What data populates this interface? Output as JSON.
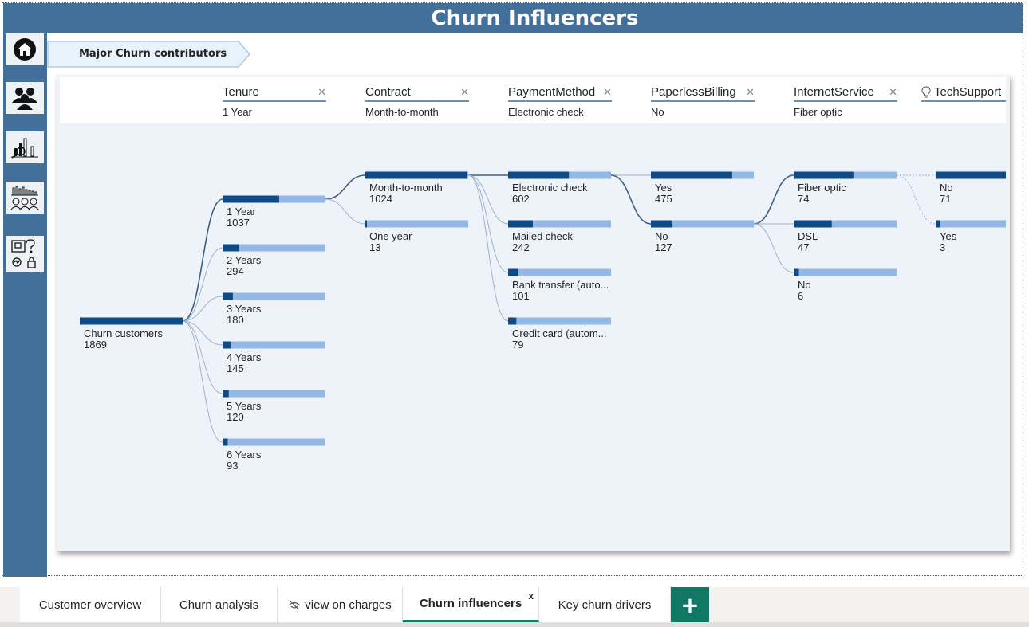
{
  "title": "Churn Influencers",
  "major_button": "Major Churn contributors",
  "nav": [
    {
      "name": "home-icon"
    },
    {
      "name": "customers-icon"
    },
    {
      "name": "analysis-chart-icon"
    },
    {
      "name": "charges-chart-icon"
    },
    {
      "name": "help-icon"
    }
  ],
  "levels": [
    {
      "name": "Tenure",
      "value": "1 Year",
      "closable": true
    },
    {
      "name": "Contract",
      "value": "Month-to-month",
      "closable": true
    },
    {
      "name": "PaymentMethod",
      "value": "Electronic check",
      "closable": true
    },
    {
      "name": "PaperlessBilling",
      "value": "No",
      "closable": true
    },
    {
      "name": "InternetService",
      "value": "Fiber optic",
      "closable": true
    },
    {
      "name": "TechSupport",
      "value": "",
      "closable": false
    }
  ],
  "colors": {
    "dark": "#0e4a85",
    "light": "#92b8e3",
    "accent": "#117865",
    "header": "#436f9b"
  },
  "chart_data": {
    "type": "decomposition-tree",
    "root": {
      "label": "Churn customers",
      "value": 1869,
      "share": 1.0
    },
    "columns": [
      [
        {
          "label": "1 Year",
          "value": 1037,
          "share": 0.55,
          "selected": true
        },
        {
          "label": "2 Years",
          "value": 294,
          "share": 0.16
        },
        {
          "label": "3 Years",
          "value": 180,
          "share": 0.1
        },
        {
          "label": "4 Years",
          "value": 145,
          "share": 0.08
        },
        {
          "label": "5 Years",
          "value": 120,
          "share": 0.06
        },
        {
          "label": "6 Years",
          "value": 93,
          "share": 0.05
        }
      ],
      [
        {
          "label": "Month-to-month",
          "value": 1024,
          "share": 0.99,
          "selected": true
        },
        {
          "label": "One year",
          "value": 13,
          "share": 0.01
        }
      ],
      [
        {
          "label": "Electronic check",
          "value": 602,
          "share": 0.59,
          "selected": true
        },
        {
          "label": "Mailed check",
          "value": 242,
          "share": 0.24
        },
        {
          "label": "Bank transfer (auto...",
          "value": 101,
          "share": 0.1
        },
        {
          "label": "Credit card (autom...",
          "value": 79,
          "share": 0.08
        }
      ],
      [
        {
          "label": "Yes",
          "value": 475,
          "share": 0.79
        },
        {
          "label": "No",
          "value": 127,
          "share": 0.21,
          "selected": true
        }
      ],
      [
        {
          "label": "Fiber optic",
          "value": 74,
          "share": 0.58,
          "selected": true
        },
        {
          "label": "DSL",
          "value": 47,
          "share": 0.37
        },
        {
          "label": "No",
          "value": 6,
          "share": 0.05
        }
      ],
      [
        {
          "label": "No",
          "value": 71,
          "share": 0.96
        },
        {
          "label": "Yes",
          "value": 3,
          "share": 0.04
        }
      ]
    ]
  },
  "tabs": [
    {
      "label": "Customer overview",
      "active": false
    },
    {
      "label": "Churn analysis",
      "active": false
    },
    {
      "label": "view on charges",
      "active": false,
      "hidden": true
    },
    {
      "label": "Churn influencers",
      "active": true,
      "close": "x"
    },
    {
      "label": "Key churn drivers",
      "active": false
    }
  ],
  "add_tab": "+"
}
